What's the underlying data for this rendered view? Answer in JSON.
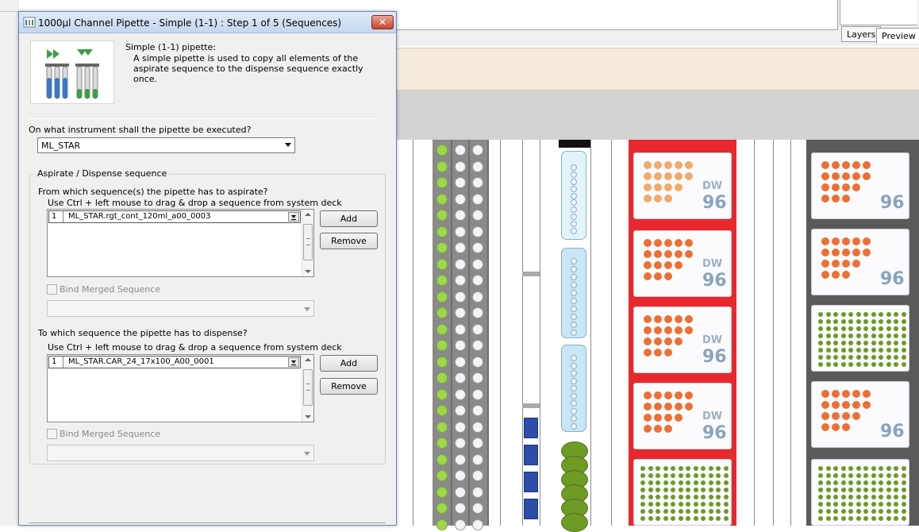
{
  "dialog": {
    "title": "1000µl Channel Pipette - Simple (1-1) : Step 1 of 5 (Sequences)",
    "close_label": "✕",
    "description_title": "Simple (1-1) pipette:",
    "description_text": "A simple pipette is used to copy all elements of the aspirate sequence to the dispense sequence exactly once.",
    "instrument_question": "On what instrument shall the pipette be executed?",
    "instrument_value": "ML_STAR",
    "group_label": "Aspirate / Dispense sequence",
    "aspirate": {
      "question": "From which sequence(s) the pipette has to aspirate?",
      "hint": "Use Ctrl + left mouse to drag & drop a sequence from system deck",
      "row_index": "1",
      "row_value": "ML_STAR.rgt_cont_120ml_a00_0003",
      "add_label": "Add",
      "remove_label": "Remove",
      "bind_label": "Bind Merged Sequence"
    },
    "dispense": {
      "question": "To which sequence the pipette has to dispense?",
      "hint": "Use Ctrl + left mouse to drag & drop a sequence from system deck",
      "row_index": "1",
      "row_value": "ML_STAR.CAR_24_17x100_A00_0001",
      "add_label": "Add",
      "remove_label": "Remove",
      "bind_label": "Bind Merged Sequence"
    }
  },
  "app": {
    "tabs": [
      {
        "label": "Layers"
      },
      {
        "label": "Preview"
      }
    ]
  },
  "deck": {
    "plate_label_dw": "DW",
    "plate_label_96": "96",
    "colors": {
      "carrier_red": "#e8282c",
      "tip_green": "#9ed64e",
      "plate_dot_orange": "#ee6e33",
      "plate_dot_green": "#6b9a25",
      "trough_blue": "#c9e6f6"
    }
  }
}
